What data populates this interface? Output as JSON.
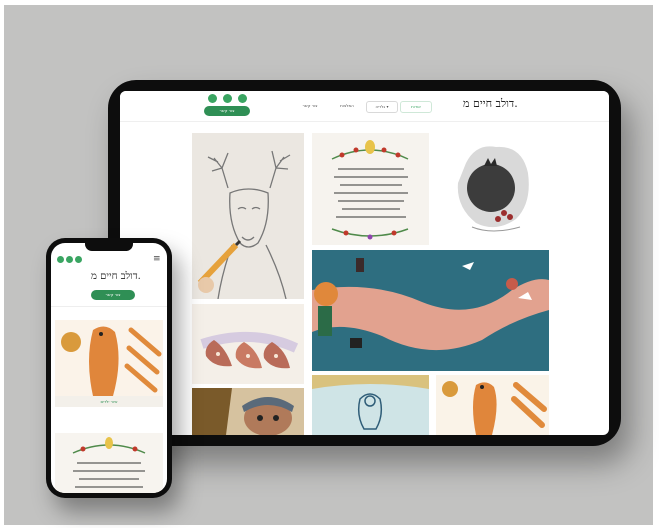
{
  "tablet": {
    "logo": "דולב חיים מ.",
    "cta_label": "צור קשר",
    "nav": [
      "צור קשר",
      "המלצות",
      "גלריה ▾",
      "אודות"
    ],
    "social": [
      "facebook-icon",
      "mail-icon",
      "whatsapp-icon"
    ]
  },
  "phone": {
    "logo": "דולב חיים מ.",
    "cta_label": "צור קשר",
    "menu_icon": "≡",
    "caption": "איור ילדים",
    "social": [
      "facebook-icon",
      "mail-icon",
      "whatsapp-icon"
    ]
  },
  "colors": {
    "accent": "#3aa562",
    "button": "#2f8f55",
    "background": "#c2c2c1",
    "device": "#0d0d0d"
  }
}
